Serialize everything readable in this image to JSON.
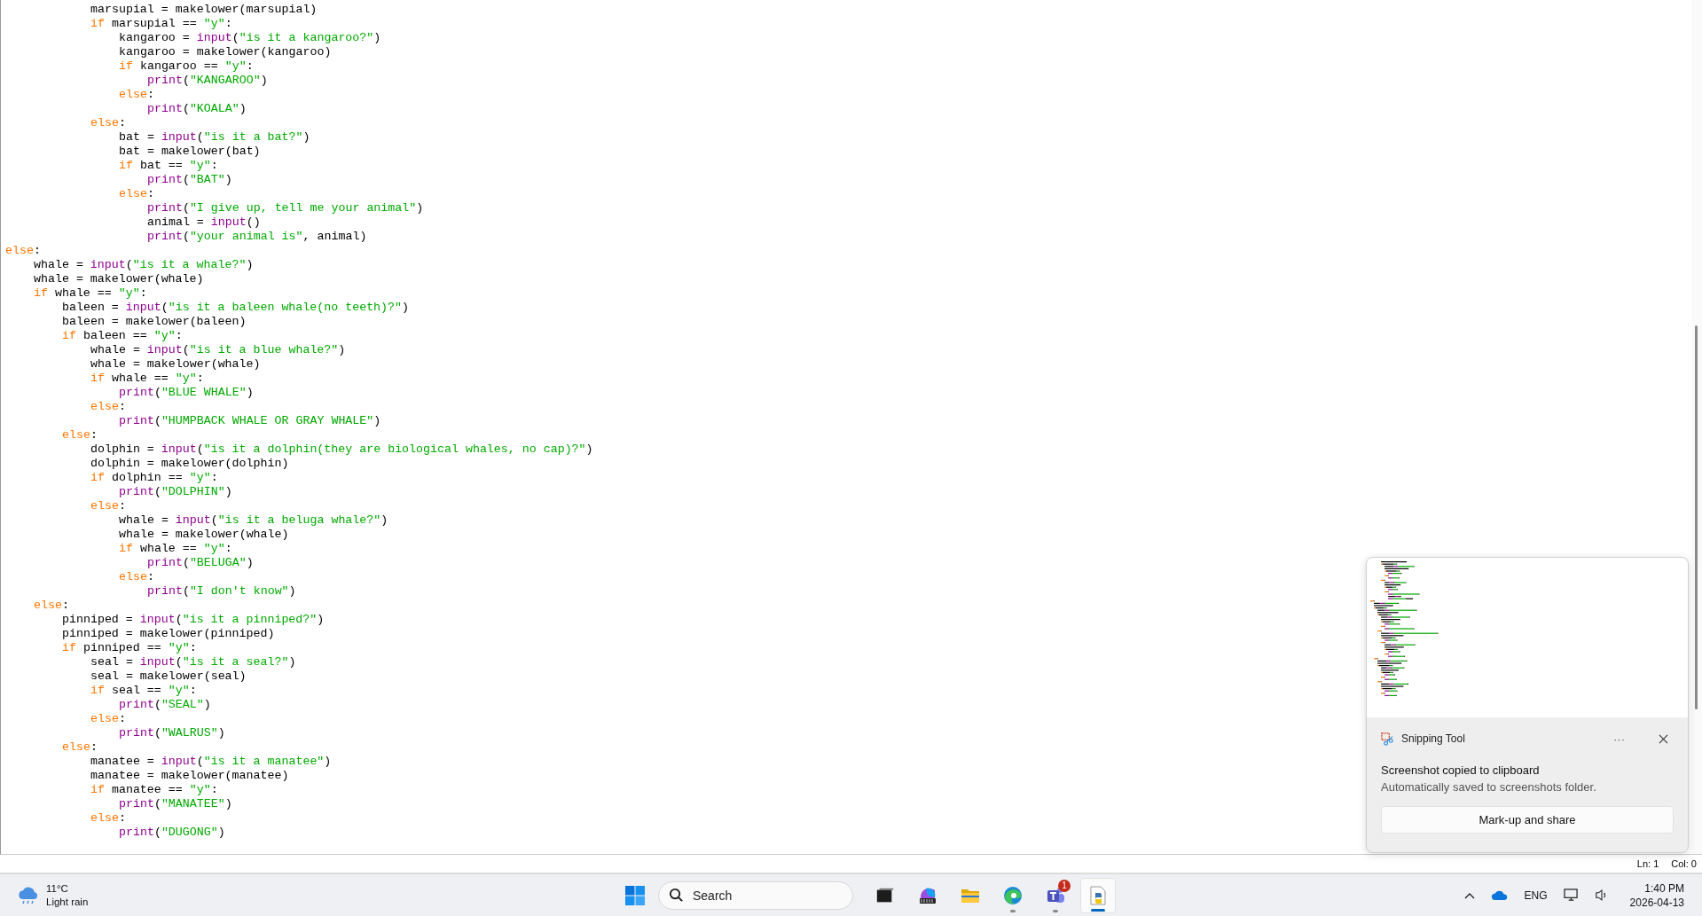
{
  "editor": {
    "code": [
      {
        "children": [
          {
            "children": [
              {
                "children": [
                  {
                    "tokens": [
                      {
                        "kind": "plain",
                        "text": "marsupial = makelower(marsupial)"
                      }
                    ]
                  },
                  {
                    "tokens": [
                      {
                        "kind": "keyword",
                        "text": "if"
                      },
                      {
                        "kind": "plain",
                        "text": " marsupial == "
                      },
                      {
                        "kind": "string",
                        "text": "\"y\""
                      },
                      {
                        "kind": "plain",
                        "text": ":"
                      }
                    ],
                    "children": [
                      {
                        "tokens": [
                          {
                            "kind": "plain",
                            "text": "kangaroo = "
                          },
                          {
                            "kind": "builtin",
                            "text": "input"
                          },
                          {
                            "kind": "plain",
                            "text": "("
                          },
                          {
                            "kind": "string",
                            "text": "\"is it a kangaroo?\""
                          },
                          {
                            "kind": "plain",
                            "text": ")"
                          }
                        ]
                      },
                      {
                        "tokens": [
                          {
                            "kind": "plain",
                            "text": "kangaroo = makelower(kangaroo)"
                          }
                        ]
                      },
                      {
                        "tokens": [
                          {
                            "kind": "keyword",
                            "text": "if"
                          },
                          {
                            "kind": "plain",
                            "text": " kangaroo == "
                          },
                          {
                            "kind": "string",
                            "text": "\"y\""
                          },
                          {
                            "kind": "plain",
                            "text": ":"
                          }
                        ],
                        "children": [
                          {
                            "tokens": [
                              {
                                "kind": "builtin",
                                "text": "print"
                              },
                              {
                                "kind": "plain",
                                "text": "("
                              },
                              {
                                "kind": "string",
                                "text": "\"KANGAROO\""
                              },
                              {
                                "kind": "plain",
                                "text": ")"
                              }
                            ]
                          }
                        ]
                      },
                      {
                        "tokens": [
                          {
                            "kind": "keyword",
                            "text": "else"
                          },
                          {
                            "kind": "plain",
                            "text": ":"
                          }
                        ],
                        "children": [
                          {
                            "tokens": [
                              {
                                "kind": "builtin",
                                "text": "print"
                              },
                              {
                                "kind": "plain",
                                "text": "("
                              },
                              {
                                "kind": "string",
                                "text": "\"KOALA\""
                              },
                              {
                                "kind": "plain",
                                "text": ")"
                              }
                            ]
                          }
                        ]
                      }
                    ]
                  },
                  {
                    "tokens": [
                      {
                        "kind": "keyword",
                        "text": "else"
                      },
                      {
                        "kind": "plain",
                        "text": ":"
                      }
                    ],
                    "children": [
                      {
                        "tokens": [
                          {
                            "kind": "plain",
                            "text": "bat = "
                          },
                          {
                            "kind": "builtin",
                            "text": "input"
                          },
                          {
                            "kind": "plain",
                            "text": "("
                          },
                          {
                            "kind": "string",
                            "text": "\"is it a bat?\""
                          },
                          {
                            "kind": "plain",
                            "text": ")"
                          }
                        ]
                      },
                      {
                        "tokens": [
                          {
                            "kind": "plain",
                            "text": "bat = makelower(bat)"
                          }
                        ]
                      },
                      {
                        "tokens": [
                          {
                            "kind": "keyword",
                            "text": "if"
                          },
                          {
                            "kind": "plain",
                            "text": " bat == "
                          },
                          {
                            "kind": "string",
                            "text": "\"y\""
                          },
                          {
                            "kind": "plain",
                            "text": ":"
                          }
                        ],
                        "children": [
                          {
                            "tokens": [
                              {
                                "kind": "builtin",
                                "text": "print"
                              },
                              {
                                "kind": "plain",
                                "text": "("
                              },
                              {
                                "kind": "string",
                                "text": "\"BAT\""
                              },
                              {
                                "kind": "plain",
                                "text": ")"
                              }
                            ]
                          }
                        ]
                      },
                      {
                        "tokens": [
                          {
                            "kind": "keyword",
                            "text": "else"
                          },
                          {
                            "kind": "plain",
                            "text": ":"
                          }
                        ],
                        "children": [
                          {
                            "tokens": [
                              {
                                "kind": "builtin",
                                "text": "print"
                              },
                              {
                                "kind": "plain",
                                "text": "("
                              },
                              {
                                "kind": "string",
                                "text": "\"I give up, tell me your animal\""
                              },
                              {
                                "kind": "plain",
                                "text": ")"
                              }
                            ]
                          },
                          {
                            "tokens": [
                              {
                                "kind": "plain",
                                "text": "animal = "
                              },
                              {
                                "kind": "builtin",
                                "text": "input"
                              },
                              {
                                "kind": "plain",
                                "text": "()"
                              }
                            ]
                          },
                          {
                            "tokens": [
                              {
                                "kind": "builtin",
                                "text": "print"
                              },
                              {
                                "kind": "plain",
                                "text": "("
                              },
                              {
                                "kind": "string",
                                "text": "\"your animal is\""
                              },
                              {
                                "kind": "plain",
                                "text": ", animal)"
                              }
                            ]
                          }
                        ]
                      }
                    ]
                  }
                ]
              }
            ]
          }
        ]
      },
      {
        "tokens": [
          {
            "kind": "keyword",
            "text": "else"
          },
          {
            "kind": "plain",
            "text": ":"
          }
        ],
        "children": [
          {
            "tokens": [
              {
                "kind": "plain",
                "text": "whale = "
              },
              {
                "kind": "builtin",
                "text": "input"
              },
              {
                "kind": "plain",
                "text": "("
              },
              {
                "kind": "string",
                "text": "\"is it a whale?\""
              },
              {
                "kind": "plain",
                "text": ")"
              }
            ]
          },
          {
            "tokens": [
              {
                "kind": "plain",
                "text": "whale = makelower(whale)"
              }
            ]
          },
          {
            "tokens": [
              {
                "kind": "keyword",
                "text": "if"
              },
              {
                "kind": "plain",
                "text": " whale == "
              },
              {
                "kind": "string",
                "text": "\"y\""
              },
              {
                "kind": "plain",
                "text": ":"
              }
            ],
            "children": [
              {
                "tokens": [
                  {
                    "kind": "plain",
                    "text": "baleen = "
                  },
                  {
                    "kind": "builtin",
                    "text": "input"
                  },
                  {
                    "kind": "plain",
                    "text": "("
                  },
                  {
                    "kind": "string",
                    "text": "\"is it a baleen whale(no teeth)?\""
                  },
                  {
                    "kind": "plain",
                    "text": ")"
                  }
                ]
              },
              {
                "tokens": [
                  {
                    "kind": "plain",
                    "text": "baleen = makelower(baleen)"
                  }
                ]
              },
              {
                "tokens": [
                  {
                    "kind": "keyword",
                    "text": "if"
                  },
                  {
                    "kind": "plain",
                    "text": " baleen == "
                  },
                  {
                    "kind": "string",
                    "text": "\"y\""
                  },
                  {
                    "kind": "plain",
                    "text": ":"
                  }
                ],
                "children": [
                  {
                    "tokens": [
                      {
                        "kind": "plain",
                        "text": "whale = "
                      },
                      {
                        "kind": "builtin",
                        "text": "input"
                      },
                      {
                        "kind": "plain",
                        "text": "("
                      },
                      {
                        "kind": "string",
                        "text": "\"is it a blue whale?\""
                      },
                      {
                        "kind": "plain",
                        "text": ")"
                      }
                    ]
                  },
                  {
                    "tokens": [
                      {
                        "kind": "plain",
                        "text": "whale = makelower(whale)"
                      }
                    ]
                  },
                  {
                    "tokens": [
                      {
                        "kind": "keyword",
                        "text": "if"
                      },
                      {
                        "kind": "plain",
                        "text": " whale == "
                      },
                      {
                        "kind": "string",
                        "text": "\"y\""
                      },
                      {
                        "kind": "plain",
                        "text": ":"
                      }
                    ],
                    "children": [
                      {
                        "tokens": [
                          {
                            "kind": "builtin",
                            "text": "print"
                          },
                          {
                            "kind": "plain",
                            "text": "("
                          },
                          {
                            "kind": "string",
                            "text": "\"BLUE WHALE\""
                          },
                          {
                            "kind": "plain",
                            "text": ")"
                          }
                        ]
                      }
                    ]
                  },
                  {
                    "tokens": [
                      {
                        "kind": "keyword",
                        "text": "else"
                      },
                      {
                        "kind": "plain",
                        "text": ":"
                      }
                    ],
                    "children": [
                      {
                        "tokens": [
                          {
                            "kind": "builtin",
                            "text": "print"
                          },
                          {
                            "kind": "plain",
                            "text": "("
                          },
                          {
                            "kind": "string",
                            "text": "\"HUMPBACK WHALE OR GRAY WHALE\""
                          },
                          {
                            "kind": "plain",
                            "text": ")"
                          }
                        ]
                      }
                    ]
                  }
                ]
              },
              {
                "tokens": [
                  {
                    "kind": "keyword",
                    "text": "else"
                  },
                  {
                    "kind": "plain",
                    "text": ":"
                  }
                ],
                "children": [
                  {
                    "tokens": [
                      {
                        "kind": "plain",
                        "text": "dolphin = "
                      },
                      {
                        "kind": "builtin",
                        "text": "input"
                      },
                      {
                        "kind": "plain",
                        "text": "("
                      },
                      {
                        "kind": "string",
                        "text": "\"is it a dolphin(they are biological whales, no cap)?\""
                      },
                      {
                        "kind": "plain",
                        "text": ")"
                      }
                    ]
                  },
                  {
                    "tokens": [
                      {
                        "kind": "plain",
                        "text": "dolphin = makelower(dolphin)"
                      }
                    ]
                  },
                  {
                    "tokens": [
                      {
                        "kind": "keyword",
                        "text": "if"
                      },
                      {
                        "kind": "plain",
                        "text": " dolphin == "
                      },
                      {
                        "kind": "string",
                        "text": "\"y\""
                      },
                      {
                        "kind": "plain",
                        "text": ":"
                      }
                    ],
                    "children": [
                      {
                        "tokens": [
                          {
                            "kind": "builtin",
                            "text": "print"
                          },
                          {
                            "kind": "plain",
                            "text": "("
                          },
                          {
                            "kind": "string",
                            "text": "\"DOLPHIN\""
                          },
                          {
                            "kind": "plain",
                            "text": ")"
                          }
                        ]
                      }
                    ]
                  },
                  {
                    "tokens": [
                      {
                        "kind": "keyword",
                        "text": "else"
                      },
                      {
                        "kind": "plain",
                        "text": ":"
                      }
                    ],
                    "children": [
                      {
                        "tokens": [
                          {
                            "kind": "plain",
                            "text": "whale = "
                          },
                          {
                            "kind": "builtin",
                            "text": "input"
                          },
                          {
                            "kind": "plain",
                            "text": "("
                          },
                          {
                            "kind": "string",
                            "text": "\"is it a beluga whale?\""
                          },
                          {
                            "kind": "plain",
                            "text": ")"
                          }
                        ]
                      },
                      {
                        "tokens": [
                          {
                            "kind": "plain",
                            "text": "whale = makelower(whale)"
                          }
                        ]
                      },
                      {
                        "tokens": [
                          {
                            "kind": "keyword",
                            "text": "if"
                          },
                          {
                            "kind": "plain",
                            "text": " whale == "
                          },
                          {
                            "kind": "string",
                            "text": "\"y\""
                          },
                          {
                            "kind": "plain",
                            "text": ":"
                          }
                        ],
                        "children": [
                          {
                            "tokens": [
                              {
                                "kind": "builtin",
                                "text": "print"
                              },
                              {
                                "kind": "plain",
                                "text": "("
                              },
                              {
                                "kind": "string",
                                "text": "\"BELUGA\""
                              },
                              {
                                "kind": "plain",
                                "text": ")"
                              }
                            ]
                          }
                        ]
                      },
                      {
                        "tokens": [
                          {
                            "kind": "keyword",
                            "text": "else"
                          },
                          {
                            "kind": "plain",
                            "text": ":"
                          }
                        ],
                        "children": [
                          {
                            "tokens": [
                              {
                                "kind": "builtin",
                                "text": "print"
                              },
                              {
                                "kind": "plain",
                                "text": "("
                              },
                              {
                                "kind": "string",
                                "text": "\"I don't know\""
                              },
                              {
                                "kind": "plain",
                                "text": ")"
                              }
                            ]
                          }
                        ]
                      }
                    ]
                  }
                ]
              }
            ]
          },
          {
            "tokens": [
              {
                "kind": "keyword",
                "text": "else"
              },
              {
                "kind": "plain",
                "text": ":"
              }
            ],
            "children": [
              {
                "tokens": [
                  {
                    "kind": "plain",
                    "text": "pinniped = "
                  },
                  {
                    "kind": "builtin",
                    "text": "input"
                  },
                  {
                    "kind": "plain",
                    "text": "("
                  },
                  {
                    "kind": "string",
                    "text": "\"is it a pinniped?\""
                  },
                  {
                    "kind": "plain",
                    "text": ")"
                  }
                ]
              },
              {
                "tokens": [
                  {
                    "kind": "plain",
                    "text": "pinniped = makelower(pinniped)"
                  }
                ]
              },
              {
                "tokens": [
                  {
                    "kind": "keyword",
                    "text": "if"
                  },
                  {
                    "kind": "plain",
                    "text": " pinniped == "
                  },
                  {
                    "kind": "string",
                    "text": "\"y\""
                  },
                  {
                    "kind": "plain",
                    "text": ":"
                  }
                ],
                "children": [
                  {
                    "tokens": [
                      {
                        "kind": "plain",
                        "text": "seal = "
                      },
                      {
                        "kind": "builtin",
                        "text": "input"
                      },
                      {
                        "kind": "plain",
                        "text": "("
                      },
                      {
                        "kind": "string",
                        "text": "\"is it a seal?\""
                      },
                      {
                        "kind": "plain",
                        "text": ")"
                      }
                    ]
                  },
                  {
                    "tokens": [
                      {
                        "kind": "plain",
                        "text": "seal = makelower(seal)"
                      }
                    ]
                  },
                  {
                    "tokens": [
                      {
                        "kind": "keyword",
                        "text": "if"
                      },
                      {
                        "kind": "plain",
                        "text": " seal == "
                      },
                      {
                        "kind": "string",
                        "text": "\"y\""
                      },
                      {
                        "kind": "plain",
                        "text": ":"
                      }
                    ],
                    "children": [
                      {
                        "tokens": [
                          {
                            "kind": "builtin",
                            "text": "print"
                          },
                          {
                            "kind": "plain",
                            "text": "("
                          },
                          {
                            "kind": "string",
                            "text": "\"SEAL\""
                          },
                          {
                            "kind": "plain",
                            "text": ")"
                          }
                        ]
                      }
                    ]
                  },
                  {
                    "tokens": [
                      {
                        "kind": "keyword",
                        "text": "else"
                      },
                      {
                        "kind": "plain",
                        "text": ":"
                      }
                    ],
                    "children": [
                      {
                        "tokens": [
                          {
                            "kind": "builtin",
                            "text": "print"
                          },
                          {
                            "kind": "plain",
                            "text": "("
                          },
                          {
                            "kind": "string",
                            "text": "\"WALRUS\""
                          },
                          {
                            "kind": "plain",
                            "text": ")"
                          }
                        ]
                      }
                    ]
                  }
                ]
              },
              {
                "tokens": [
                  {
                    "kind": "keyword",
                    "text": "else"
                  },
                  {
                    "kind": "plain",
                    "text": ":"
                  }
                ],
                "children": [
                  {
                    "tokens": [
                      {
                        "kind": "plain",
                        "text": "manatee = "
                      },
                      {
                        "kind": "builtin",
                        "text": "input"
                      },
                      {
                        "kind": "plain",
                        "text": "("
                      },
                      {
                        "kind": "string",
                        "text": "\"is it a manatee\""
                      },
                      {
                        "kind": "plain",
                        "text": ")"
                      }
                    ]
                  },
                  {
                    "tokens": [
                      {
                        "kind": "plain",
                        "text": "manatee = makelower(manatee)"
                      }
                    ]
                  },
                  {
                    "tokens": [
                      {
                        "kind": "keyword",
                        "text": "if"
                      },
                      {
                        "kind": "plain",
                        "text": " manatee == "
                      },
                      {
                        "kind": "string",
                        "text": "\"y\""
                      },
                      {
                        "kind": "plain",
                        "text": ":"
                      }
                    ],
                    "children": [
                      {
                        "tokens": [
                          {
                            "kind": "builtin",
                            "text": "print"
                          },
                          {
                            "kind": "plain",
                            "text": "("
                          },
                          {
                            "kind": "string",
                            "text": "\"MANATEE\""
                          },
                          {
                            "kind": "plain",
                            "text": ")"
                          }
                        ]
                      }
                    ]
                  },
                  {
                    "tokens": [
                      {
                        "kind": "keyword",
                        "text": "else"
                      },
                      {
                        "kind": "plain",
                        "text": ":"
                      }
                    ],
                    "children": [
                      {
                        "tokens": [
                          {
                            "kind": "builtin",
                            "text": "print"
                          },
                          {
                            "kind": "plain",
                            "text": "("
                          },
                          {
                            "kind": "string",
                            "text": "\"DUGONG\""
                          },
                          {
                            "kind": "plain",
                            "text": ")"
                          }
                        ]
                      }
                    ]
                  }
                ]
              }
            ]
          }
        ]
      }
    ]
  },
  "status_bar": {
    "line": "Ln: 1",
    "column": "Col: 0"
  },
  "notification": {
    "app": "Snipping Tool",
    "more": "···",
    "title": "Screenshot copied to clipboard",
    "message": "Automatically saved to screenshots folder.",
    "button": "Mark-up and share"
  },
  "taskbar": {
    "weather": {
      "temperature": "11°C",
      "condition": "Light rain"
    },
    "search": {
      "placeholder": "Search"
    },
    "apps": [
      {
        "kind": "taskview",
        "running": false,
        "selected": false
      },
      {
        "kind": "office",
        "running": false,
        "selected": false
      },
      {
        "kind": "folder",
        "running": false,
        "selected": false
      },
      {
        "kind": "browser",
        "running": true,
        "selected": false
      },
      {
        "kind": "teams",
        "running": true,
        "selected": false,
        "badge": "1"
      },
      {
        "kind": "python",
        "running": true,
        "selected": true
      }
    ],
    "tray": {
      "language": "ENG",
      "time": "1:40 PM",
      "date": "2026-04-13"
    }
  }
}
